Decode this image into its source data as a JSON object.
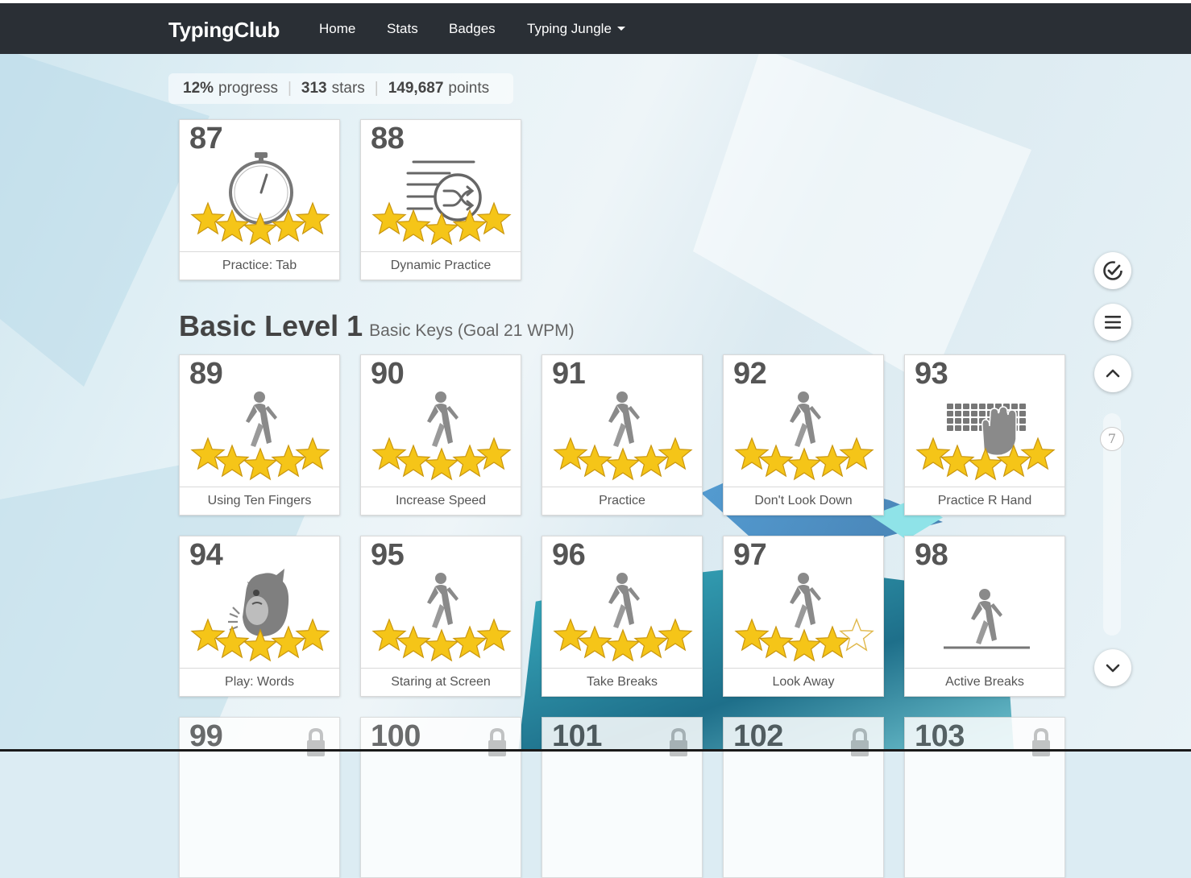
{
  "navbar": {
    "brand": "TypingClub",
    "links": [
      "Home",
      "Stats",
      "Badges"
    ],
    "dropdown": "Typing Jungle"
  },
  "stats": {
    "progress_value": "12%",
    "progress_label": "progress",
    "stars_value": "313",
    "stars_label": "stars",
    "points_value": "149,687",
    "points_label": "points"
  },
  "level": {
    "title": "Basic Level 1",
    "subtitle": "Basic Keys (Goal 21 WPM)"
  },
  "lessons": [
    {
      "num": "87",
      "label": "Practice: Tab",
      "icon": "stopwatch-icon",
      "stars": 5
    },
    {
      "num": "88",
      "label": "Dynamic Practice",
      "icon": "shuffle-lines-icon",
      "stars": 5
    },
    {
      "num": "89",
      "label": "Using Ten Fingers",
      "icon": "walking-person-icon",
      "stars": 5
    },
    {
      "num": "90",
      "label": "Increase Speed",
      "icon": "walking-person-icon",
      "stars": 5
    },
    {
      "num": "91",
      "label": "Practice",
      "icon": "walking-person-icon",
      "stars": 5
    },
    {
      "num": "92",
      "label": "Don't Look Down",
      "icon": "walking-person-icon",
      "stars": 5
    },
    {
      "num": "93",
      "label": "Practice R Hand",
      "icon": "keyboard-hand-icon",
      "stars": 5
    },
    {
      "num": "94",
      "label": "Play: Words",
      "icon": "monster-game-icon",
      "stars": 5
    },
    {
      "num": "95",
      "label": "Staring at Screen",
      "icon": "walking-person-icon",
      "stars": 5
    },
    {
      "num": "96",
      "label": "Take Breaks",
      "icon": "walking-person-icon",
      "stars": 5
    },
    {
      "num": "97",
      "label": "Look Away",
      "icon": "walking-person-icon",
      "stars": 4
    },
    {
      "num": "98",
      "label": "Active Breaks",
      "icon": "walking-person-icon",
      "stars": 0
    },
    {
      "num": "99",
      "label": "",
      "icon": "lock-icon",
      "locked": true
    },
    {
      "num": "100",
      "label": "",
      "icon": "lock-icon",
      "locked": true
    },
    {
      "num": "101",
      "label": "",
      "icon": "lock-icon",
      "locked": true
    },
    {
      "num": "102",
      "label": "",
      "icon": "lock-icon",
      "locked": true
    },
    {
      "num": "103",
      "label": "",
      "icon": "lock-icon",
      "locked": true
    }
  ],
  "sidebar": {
    "buttons": [
      "check-circle-icon",
      "menu-icon",
      "chevron-up-icon",
      "chevron-down-icon"
    ],
    "scroll_marker": "7"
  },
  "colors": {
    "navbar": "#2a2f35",
    "star_gold": "#f5c518",
    "text_dark": "#555555"
  }
}
